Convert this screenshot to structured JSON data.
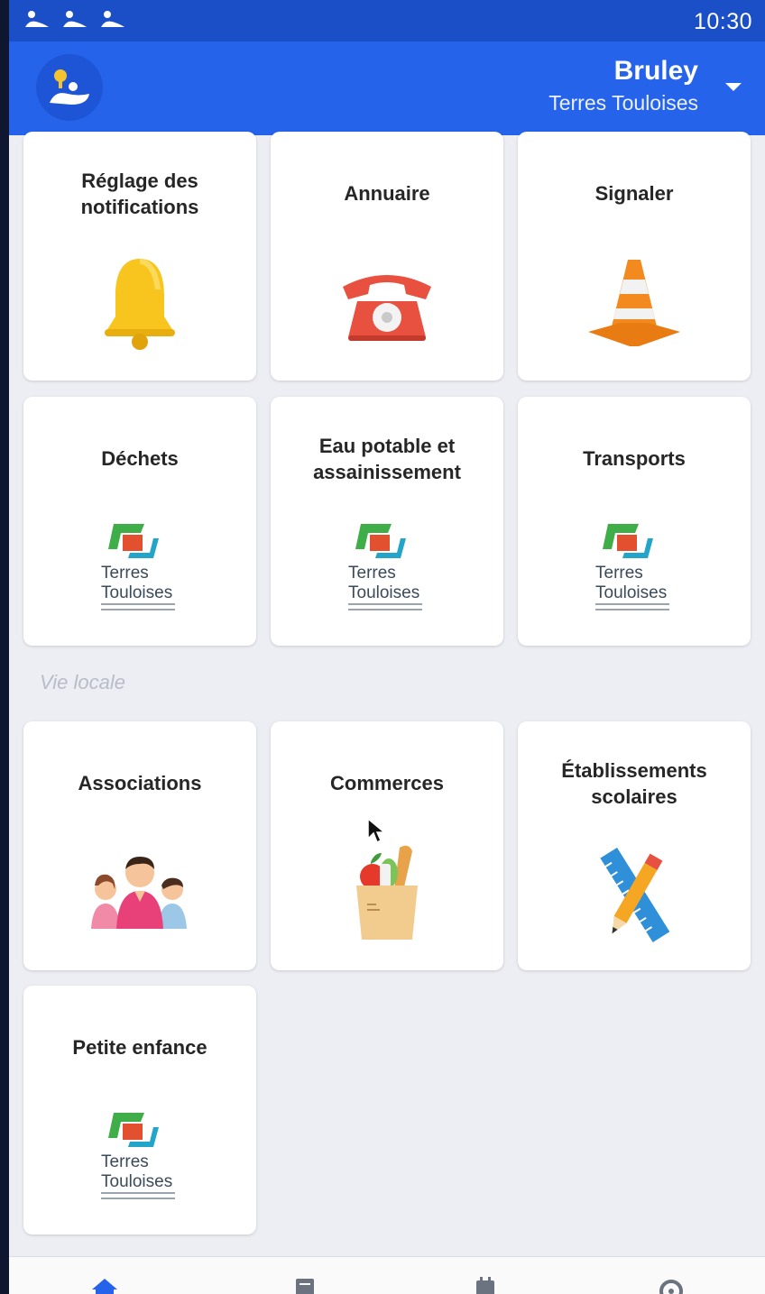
{
  "statusbar": {
    "time": "10:30"
  },
  "header": {
    "town": "Bruley",
    "region": "Terres Touloises"
  },
  "section_vie_locale": "Vie locale",
  "tiles": [
    {
      "label": "Réglage des notifications",
      "icon": "bell-icon"
    },
    {
      "label": "Annuaire",
      "icon": "telephone-icon"
    },
    {
      "label": "Signaler",
      "icon": "traffic-cone-icon"
    },
    {
      "label": "Déchets",
      "icon": "terres-touloises-logo"
    },
    {
      "label": "Eau potable et assainissement",
      "icon": "terres-touloises-logo"
    },
    {
      "label": "Transports",
      "icon": "terres-touloises-logo"
    },
    {
      "label": "Associations",
      "icon": "people-icon"
    },
    {
      "label": "Commerces",
      "icon": "grocery-bag-icon"
    },
    {
      "label": "Établissements scolaires",
      "icon": "ruler-pencil-icon"
    },
    {
      "label": "Petite enfance",
      "icon": "terres-touloises-logo"
    }
  ],
  "logo_text": {
    "line1": "Terres",
    "line2": "Touloises"
  },
  "colors": {
    "primary": "#2563eb",
    "statusbar": "#1a4fc7",
    "background": "#eceef3"
  },
  "bottom_nav": [
    "home-icon",
    "news-icon",
    "calendar-icon",
    "settings-icon"
  ]
}
